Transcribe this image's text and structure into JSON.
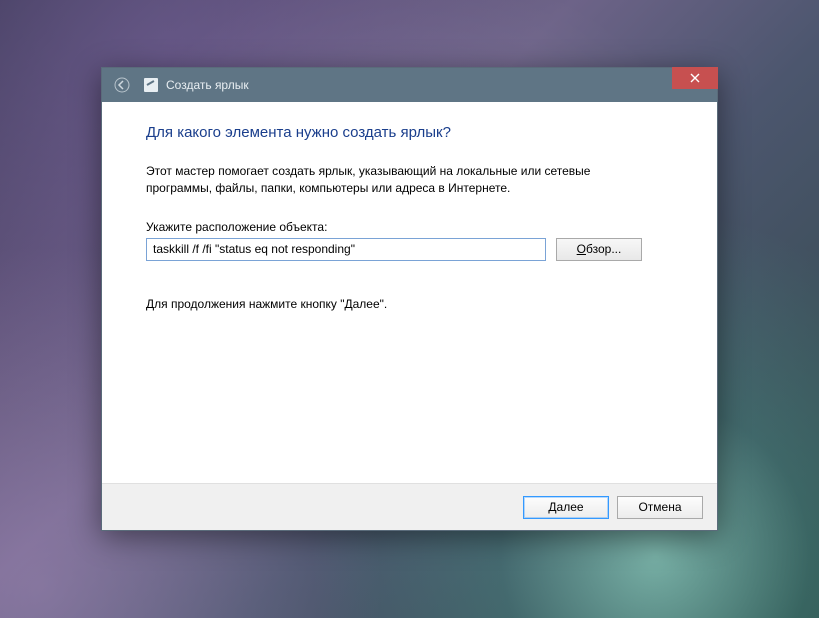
{
  "titlebar": {
    "title": "Создать ярлык"
  },
  "content": {
    "heading": "Для какого элемента нужно создать ярлык?",
    "description": "Этот мастер помогает создать ярлык, указывающий на локальные или сетевые программы, файлы, папки, компьютеры или адреса в Интернете.",
    "location_label": "Укажите расположение объекта:",
    "location_value": "taskkill /f /fi \"status eq not responding\"",
    "browse_prefix": "О",
    "browse_rest": "бзор...",
    "continue_hint": "Для продолжения нажмите кнопку \"Далее\"."
  },
  "footer": {
    "next_prefix": "Д",
    "next_rest": "алее",
    "cancel_label": "Отмена"
  }
}
